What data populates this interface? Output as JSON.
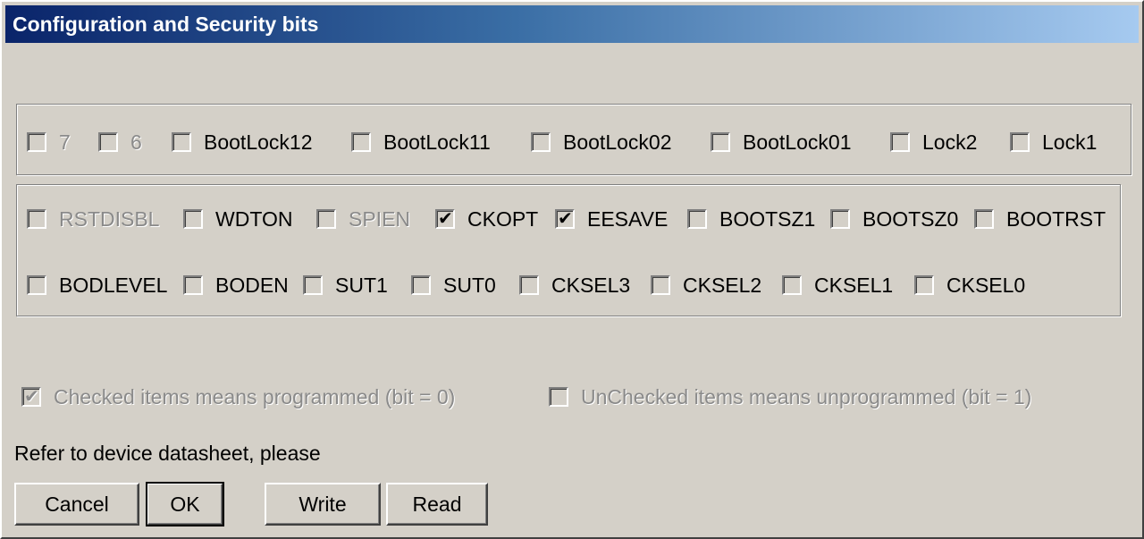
{
  "title": "Configuration and Security bits",
  "lock_bits": [
    {
      "label": "7",
      "checked": false,
      "disabled": true
    },
    {
      "label": "6",
      "checked": false,
      "disabled": true
    },
    {
      "label": "BootLock12",
      "checked": false,
      "disabled": false
    },
    {
      "label": "BootLock11",
      "checked": false,
      "disabled": false
    },
    {
      "label": "BootLock02",
      "checked": false,
      "disabled": false
    },
    {
      "label": "BootLock01",
      "checked": false,
      "disabled": false
    },
    {
      "label": "Lock2",
      "checked": false,
      "disabled": false
    },
    {
      "label": "Lock1",
      "checked": false,
      "disabled": false
    }
  ],
  "fuse_high": [
    {
      "label": "RSTDISBL",
      "checked": false,
      "disabled": true
    },
    {
      "label": "WDTON",
      "checked": false,
      "disabled": false
    },
    {
      "label": "SPIEN",
      "checked": false,
      "disabled": true
    },
    {
      "label": "CKOPT",
      "checked": true,
      "disabled": false
    },
    {
      "label": "EESAVE",
      "checked": true,
      "disabled": false
    },
    {
      "label": "BOOTSZ1",
      "checked": false,
      "disabled": false
    },
    {
      "label": "BOOTSZ0",
      "checked": false,
      "disabled": false
    },
    {
      "label": "BOOTRST",
      "checked": false,
      "disabled": false
    }
  ],
  "fuse_low": [
    {
      "label": "BODLEVEL",
      "checked": false,
      "disabled": false
    },
    {
      "label": "BODEN",
      "checked": false,
      "disabled": false
    },
    {
      "label": "SUT1",
      "checked": false,
      "disabled": false
    },
    {
      "label": "SUT0",
      "checked": false,
      "disabled": false
    },
    {
      "label": "CKSEL3",
      "checked": false,
      "disabled": false
    },
    {
      "label": "CKSEL2",
      "checked": false,
      "disabled": false
    },
    {
      "label": "CKSEL1",
      "checked": false,
      "disabled": false
    },
    {
      "label": "CKSEL0",
      "checked": false,
      "disabled": false
    }
  ],
  "legend": {
    "checked_label": "Checked items means programmed (bit = 0)",
    "unchecked_label": "UnChecked items means unprogrammed (bit = 1)"
  },
  "note": "Refer to device datasheet, please",
  "buttons": {
    "cancel": "Cancel",
    "ok": "OK",
    "write": "Write",
    "read": "Read"
  }
}
